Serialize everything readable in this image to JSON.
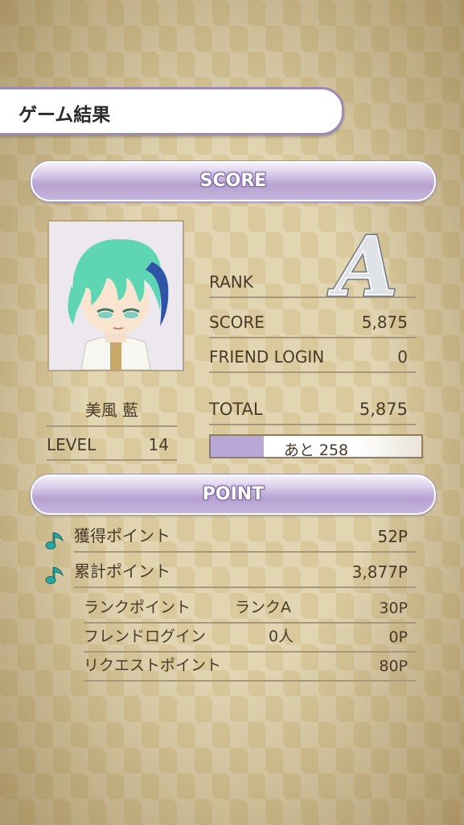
{
  "header": {
    "title": "ゲーム結果"
  },
  "score_section": {
    "label": "SCORE",
    "character_name": "美風 藍",
    "level_label": "LEVEL",
    "level_value": "14",
    "rank_label": "RANK",
    "rank_value": "A",
    "score_label": "SCORE",
    "score_value": "5,875",
    "friend_login_label": "FRIEND LOGIN",
    "friend_login_value": "0",
    "total_label": "TOTAL",
    "total_value": "5,875",
    "progress_text": "あと 258",
    "progress_fraction": 0.25
  },
  "point_section": {
    "label": "POINT",
    "earned_label": "獲得ポイント",
    "earned_value": "52P",
    "cumulative_label": "累計ポイント",
    "cumulative_value": "3,877P",
    "breakdown": [
      {
        "label": "ランクポイント",
        "detail": "ランクA",
        "value": "30P"
      },
      {
        "label": "フレンドログイン",
        "detail": "0人",
        "value": "0P"
      },
      {
        "label": "リクエストポイント",
        "detail": "",
        "value": "80P"
      }
    ]
  },
  "colors": {
    "accent": "#b6a1d0",
    "note_icon": "#2aa6a0",
    "hair": "#5fd6b3"
  },
  "icons": [
    "music-note-icon",
    "character-portrait",
    "rank-a-badge"
  ]
}
